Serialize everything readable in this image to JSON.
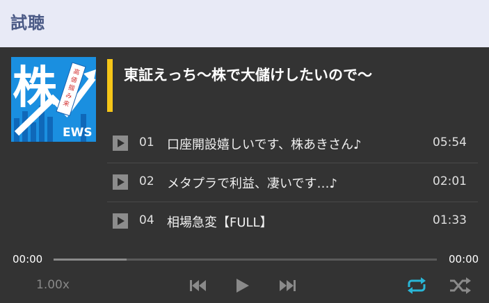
{
  "header": {
    "title": "試聴"
  },
  "album": {
    "title": "東証えっち〜株で大儲けしたいので〜",
    "cover_kanji": "株",
    "cover_badge_text": "高値掴み来所を覚悟しろ！",
    "cover_sub": "EWS"
  },
  "tracks": [
    {
      "num": "01",
      "title": "口座開設嬉しいです、株あきさん♪",
      "duration": "05:54"
    },
    {
      "num": "02",
      "title": "メタプラで利益、凄いです…♪",
      "duration": "02:01"
    },
    {
      "num": "04",
      "title": "相場急変【FULL】",
      "duration": "01:33"
    }
  ],
  "player": {
    "current_time": "00:00",
    "total_time": "00:00",
    "progress_fraction": 0.19,
    "speed": "1.00x",
    "accent_color": "#29b6d6"
  },
  "icons": {
    "track_play": "play-icon",
    "prev": "skip-previous-icon",
    "play": "play-icon",
    "next": "skip-next-icon",
    "repeat": "repeat-icon",
    "shuffle": "shuffle-icon"
  }
}
